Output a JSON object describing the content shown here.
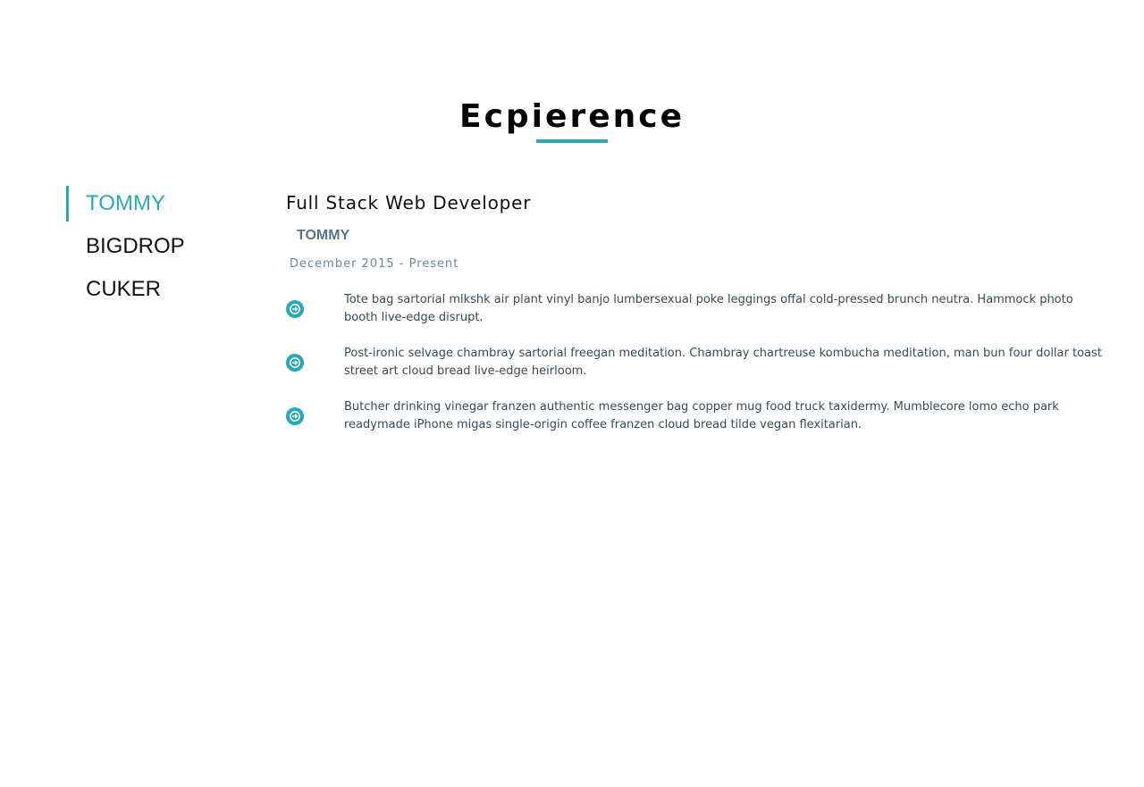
{
  "section": {
    "title": "Ecpierence"
  },
  "tabs": [
    {
      "label": "TOMMY",
      "active": true
    },
    {
      "label": "BIGDROP",
      "active": false
    },
    {
      "label": "CUKER",
      "active": false
    }
  ],
  "job": {
    "title": "Full Stack Web Developer",
    "company": "TOMMY",
    "dates": "December 2015 - Present",
    "duties": [
      {
        "icon": "arrow-circle-right-icon",
        "text": "Tote bag sartorial mlkshk air plant vinyl banjo lumbersexual poke leggings offal cold-pressed brunch neutra. Hammock photo booth live-edge disrupt."
      },
      {
        "icon": "arrow-circle-right-icon",
        "text": "Post-ironic selvage chambray sartorial freegan meditation. Chambray chartreuse kombucha meditation, man bun four dollar toast street art cloud bread live-edge heirloom."
      },
      {
        "icon": "arrow-circle-right-icon",
        "text": "Butcher drinking vinegar franzen authentic messenger bag copper mug food truck taxidermy. Mumblecore lomo echo park readymade iPhone migas single-origin coffee franzen cloud bread tilde vegan flexitarian."
      }
    ]
  },
  "colors": {
    "accent": "#2aa9b3",
    "company": "#5b7386",
    "text": "#3a4a56"
  }
}
